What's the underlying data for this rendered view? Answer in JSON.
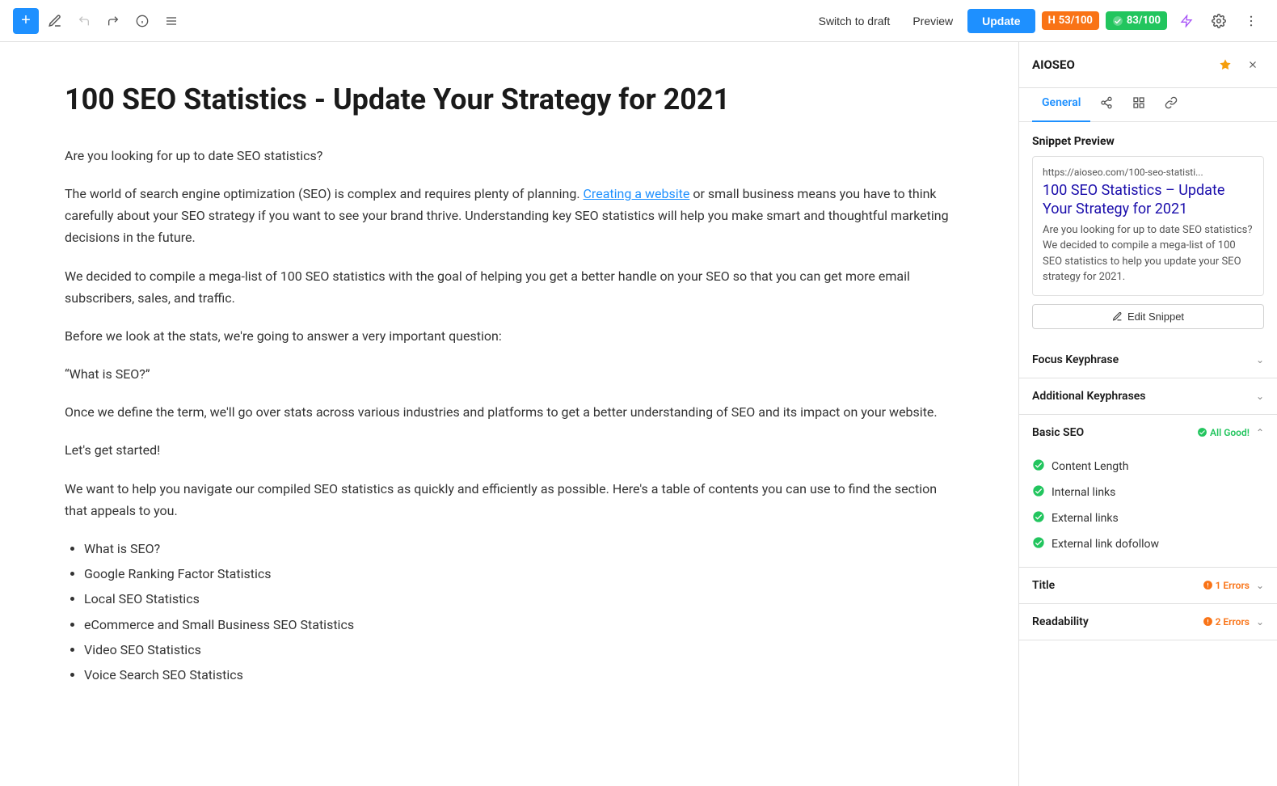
{
  "toolbar": {
    "add_label": "+",
    "switch_draft_label": "Switch to draft",
    "preview_label": "Preview",
    "update_label": "Update",
    "score_h_label": "H",
    "score_h_value": "53/100",
    "score_g_label": "",
    "score_g_value": "83/100"
  },
  "editor": {
    "title": "100 SEO Statistics - Update Your Strategy for 2021",
    "paragraphs": [
      "Are you looking for up to date SEO statistics?",
      "The world of search engine optimization (SEO) is complex and requires plenty of planning. Creating a website or small business means you have to think carefully about your SEO strategy if you want to see your brand thrive. Understanding key SEO statistics will help you make smart and thoughtful marketing decisions in the future.",
      "We decided to compile a mega-list of 100 SEO statistics with the goal of helping you get a better handle on your SEO so that you can get more email subscribers, sales, and traffic.",
      "Before we look at the stats, we're going to answer a very important question:",
      "“What is SEO?”",
      "Once we define the term, we'll go over stats across various industries and platforms to get a better understanding of SEO and its impact on your website.",
      "Let's get started!",
      "We want to help you navigate our compiled SEO statistics as quickly and efficiently as possible. Here's a table of contents you can use to find the section that appeals to you."
    ],
    "list_items": [
      "What is SEO?",
      "Google Ranking Factor Statistics",
      "Local SEO Statistics",
      "eCommerce and Small Business SEO Statistics",
      "Video SEO Statistics",
      "Voice Search SEO Statistics"
    ]
  },
  "sidebar": {
    "title": "AIOSEO",
    "tabs": [
      {
        "label": "General",
        "active": true
      },
      {
        "label": "share-icon"
      },
      {
        "label": "list-icon"
      },
      {
        "label": "link-icon"
      }
    ],
    "snippet_preview": {
      "title": "Snippet Preview",
      "url": "https://aioseo.com/100-seo-statisti...",
      "page_title": "100 SEO Statistics – Update Your Strategy for 2021",
      "description": "Are you looking for up to date SEO statistics? We decided to compile a mega-list of 100 SEO statistics to help you update your SEO strategy for 2021.",
      "edit_label": "Edit Snippet"
    },
    "focus_keyphrase": {
      "label": "Focus Keyphrase"
    },
    "additional_keyphrases": {
      "label": "Additional Keyphrases"
    },
    "basic_seo": {
      "label": "Basic SEO",
      "status": "All Good!",
      "checks": [
        {
          "label": "Content Length",
          "status": "good"
        },
        {
          "label": "Internal links",
          "status": "good"
        },
        {
          "label": "External links",
          "status": "good"
        },
        {
          "label": "External link dofollow",
          "status": "good"
        }
      ]
    },
    "title_section": {
      "label": "Title",
      "status": "1 Errors"
    },
    "readability_section": {
      "label": "Readability",
      "status": "2 Errors"
    }
  }
}
